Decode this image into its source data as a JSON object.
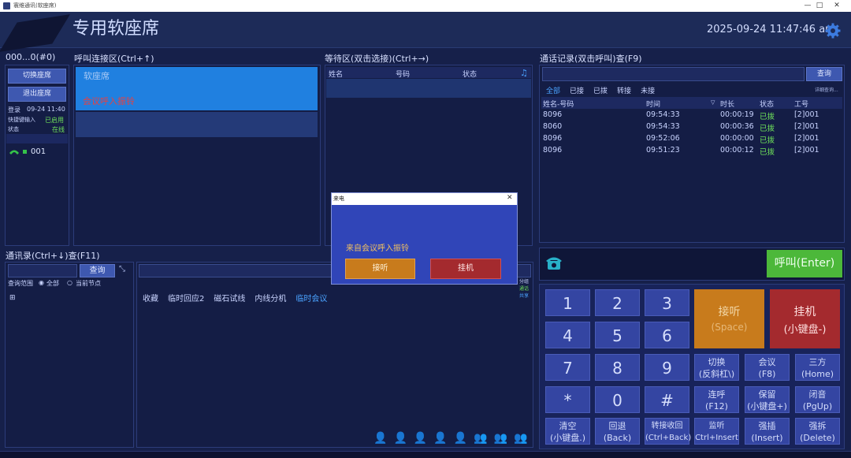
{
  "window": {
    "title": "寰维通讯(软座席)",
    "minimize": "—",
    "maximize": "□",
    "close": "✕"
  },
  "header": {
    "title": "专用软座席",
    "clock": "2025-09-24 11:47:46 am",
    "settings_icon": "gear-icon"
  },
  "agent": {
    "title": "000...0(#0)",
    "switch_btn": "切换座席",
    "exit_btn": "退出座席",
    "login_label": "登录",
    "login_time": "09-24 11:40",
    "quickkey_label": "快捷键输入",
    "quickkey_value": "已启用",
    "status_label": "状态",
    "status_value": "在线",
    "line_number": "001"
  },
  "call_area": {
    "title": "呼叫连接区(Ctrl+↑)",
    "row1": "软座席",
    "row2": "会议呼入振铃"
  },
  "wait_area": {
    "title": "等待区(双击选接)(Ctrl+→)",
    "col_name": "姓名",
    "col_number": "号码",
    "col_status": "状态"
  },
  "records": {
    "title": "通话记录(双击呼叫)查(F9)",
    "query_btn": "查询",
    "detail_link": "详细查询...",
    "tabs": [
      "全部",
      "已接",
      "已拨",
      "转接",
      "未接"
    ],
    "headers": [
      "姓名-号码",
      "时间",
      "时长",
      "状态",
      "工号"
    ],
    "rows": [
      {
        "number": "8096",
        "time": "09:54:33",
        "duration": "00:00:19",
        "status": "已拨",
        "id": "[2]001"
      },
      {
        "number": "8060",
        "time": "09:54:33",
        "duration": "00:00:36",
        "status": "已拨",
        "id": "[2]001"
      },
      {
        "number": "8096",
        "time": "09:52:06",
        "duration": "00:00:00",
        "status": "已拨",
        "id": "[2]001"
      },
      {
        "number": "8096",
        "time": "09:51:23",
        "duration": "00:00:12",
        "status": "已拨",
        "id": "[2]001"
      }
    ]
  },
  "contacts": {
    "title": "通讯录(Ctrl+↓)查(F11)",
    "query_btn": "查询",
    "scope_label": "查询范围",
    "scope_all": "全部",
    "scope_node": "当前节点",
    "tabs": [
      "收藏",
      "临时回应2",
      "磁石试线",
      "内线分机",
      "临时会议"
    ],
    "side_text": [
      "分组",
      "通话",
      "共享"
    ],
    "expand_icon": "⊞"
  },
  "dialpad": {
    "call_btn": "呼叫(Enter)",
    "answer_btn": {
      "line1": "接听",
      "line2": "(Space)"
    },
    "hangup_btn": {
      "line1": "挂机",
      "line2": "(小键盘-)"
    },
    "keys": [
      "1",
      "2",
      "3",
      "4",
      "5",
      "6",
      "7",
      "8",
      "9",
      "*",
      "0",
      "#"
    ],
    "fn_keys": [
      {
        "l1": "切换",
        "l2": "(反斜杠\\)"
      },
      {
        "l1": "会议",
        "l2": "(F8)"
      },
      {
        "l1": "三方",
        "l2": "(Home)"
      },
      {
        "l1": "连呼",
        "l2": "(F12)"
      },
      {
        "l1": "保留",
        "l2": "(小键盘+)"
      },
      {
        "l1": "闭音",
        "l2": "(PgUp)"
      },
      {
        "l1": "清空",
        "l2": "(小键盘.)"
      },
      {
        "l1": "回退",
        "l2": "(Back)"
      },
      {
        "l1": "转接收回",
        "l2": "(Ctrl+Back)"
      },
      {
        "l1": "监听",
        "l2": "Ctrl+Insert"
      },
      {
        "l1": "强插",
        "l2": "(Insert)"
      },
      {
        "l1": "强拆",
        "l2": "(Delete)"
      }
    ]
  },
  "dialog": {
    "title": "来电",
    "close": "✕",
    "message": "来自会议呼入振铃",
    "answer_btn": "接听",
    "hangup_btn": "挂机"
  },
  "colors": {
    "accent_green": "#4cb83a",
    "answer_orange": "#c87b1c",
    "hangup_red": "#a42a2e",
    "status_green": "#6ee05a",
    "ringing_red": "#e84040"
  }
}
